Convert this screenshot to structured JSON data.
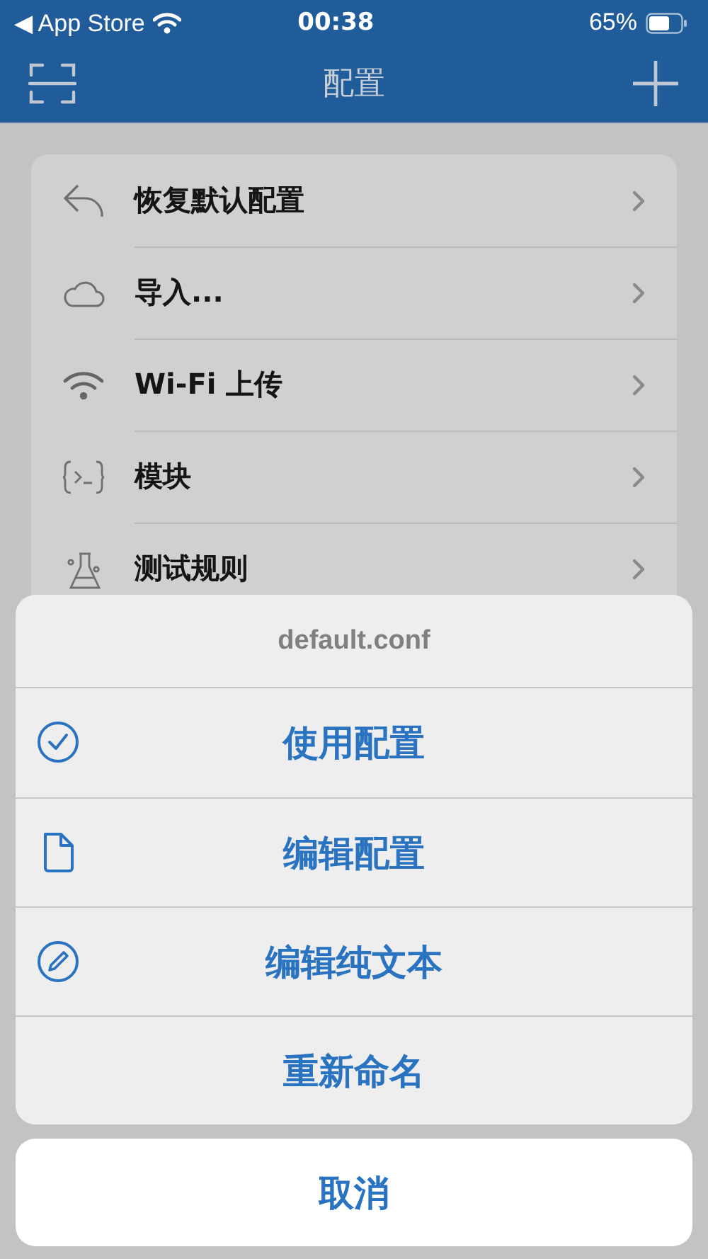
{
  "status_bar": {
    "back_label": "◀ App Store",
    "time": "00:38",
    "battery": "65%"
  },
  "nav_bar": {
    "title": "配置"
  },
  "menu": [
    {
      "label": "恢复默认配置"
    },
    {
      "label": "导入..."
    },
    {
      "label": "Wi-Fi 上传"
    },
    {
      "label": "模块"
    },
    {
      "label": "测试规则"
    }
  ],
  "action_sheet": {
    "title": "default.conf",
    "actions": [
      {
        "label": "使用配置"
      },
      {
        "label": "编辑配置"
      },
      {
        "label": "编辑纯文本"
      },
      {
        "label": "重新命名"
      }
    ],
    "cancel": "取消"
  }
}
